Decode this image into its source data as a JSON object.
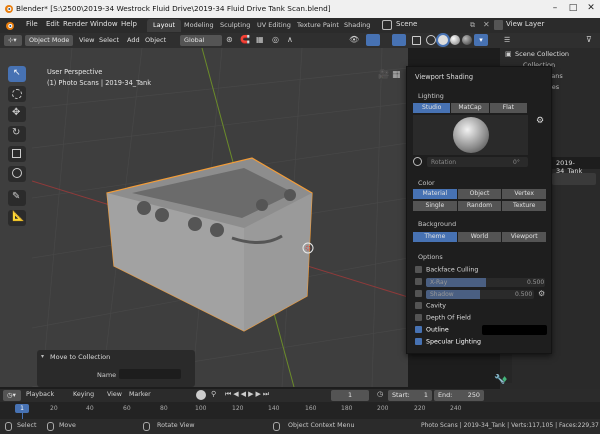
{
  "window": {
    "title": "Blender* [S:\\2500\\2019-34 Westrock Fluid Drive\\2019-34 Fluid Drive Tank Scan.blend]"
  },
  "menu": [
    "File",
    "Edit",
    "Render",
    "Window",
    "Help"
  ],
  "workspaces": [
    {
      "label": "Layout",
      "active": true
    },
    {
      "label": "Modeling"
    },
    {
      "label": "Sculpting"
    },
    {
      "label": "UV Editing"
    },
    {
      "label": "Texture Paint"
    },
    {
      "label": "Shading"
    }
  ],
  "scene": {
    "label": "Scene",
    "view_layer": "View Layer"
  },
  "header": {
    "mode": "Object Mode",
    "menus": [
      "View",
      "Select",
      "Add",
      "Object"
    ],
    "transform_orientation": "Global"
  },
  "viewport": {
    "perspective": "User Perspective",
    "collection_info": "(1) Photo Scans | 2019-34_Tank"
  },
  "move_panel": {
    "title": "Move to Collection",
    "name_label": "Name"
  },
  "outliner": {
    "title": "Scene Collection",
    "items": [
      "Collection",
      "Photo Scans",
      "References",
      "2019-34_Tank"
    ]
  },
  "shading": {
    "title": "Viewport Shading",
    "lighting_label": "Lighting",
    "lighting_options": [
      "Studio",
      "MatCap",
      "Flat"
    ],
    "lighting_selected": 0,
    "rotation_label": "Rotation",
    "rotation_value": "0°",
    "color_label": "Color",
    "color_options": [
      "Material",
      "Object",
      "Vertex",
      "Single",
      "Random",
      "Texture"
    ],
    "color_selected": 0,
    "background_label": "Background",
    "background_options": [
      "Theme",
      "World",
      "Viewport"
    ],
    "background_selected": 0,
    "options_label": "Options",
    "backface": "Backface Culling",
    "xray": "X-Ray",
    "xray_value": "0.500",
    "shadow": "Shadow",
    "shadow_value": "0.500",
    "cavity": "Cavity",
    "dof": "Depth Of Field",
    "outline": "Outline",
    "specular": "Specular Lighting"
  },
  "timeline": {
    "menus": [
      "Playback",
      "Keying",
      "View",
      "Marker"
    ],
    "current_frame": "1",
    "start_label": "Start:",
    "start": "1",
    "end_label": "End:",
    "end": "250",
    "ticks": [
      "1",
      "20",
      "40",
      "60",
      "80",
      "100",
      "120",
      "140",
      "160",
      "180",
      "200",
      "220",
      "240"
    ]
  },
  "status": {
    "select": "Select",
    "move": "Move",
    "rotate": "Rotate View",
    "context": "Object Context Menu",
    "info": "Photo Scans | 2019-34_Tank | Verts:117,105 | Faces:229,37"
  },
  "colors": {
    "accent": "#4772b3",
    "selection": "#f29c38",
    "viewport_bg": "#3e3e3e"
  }
}
